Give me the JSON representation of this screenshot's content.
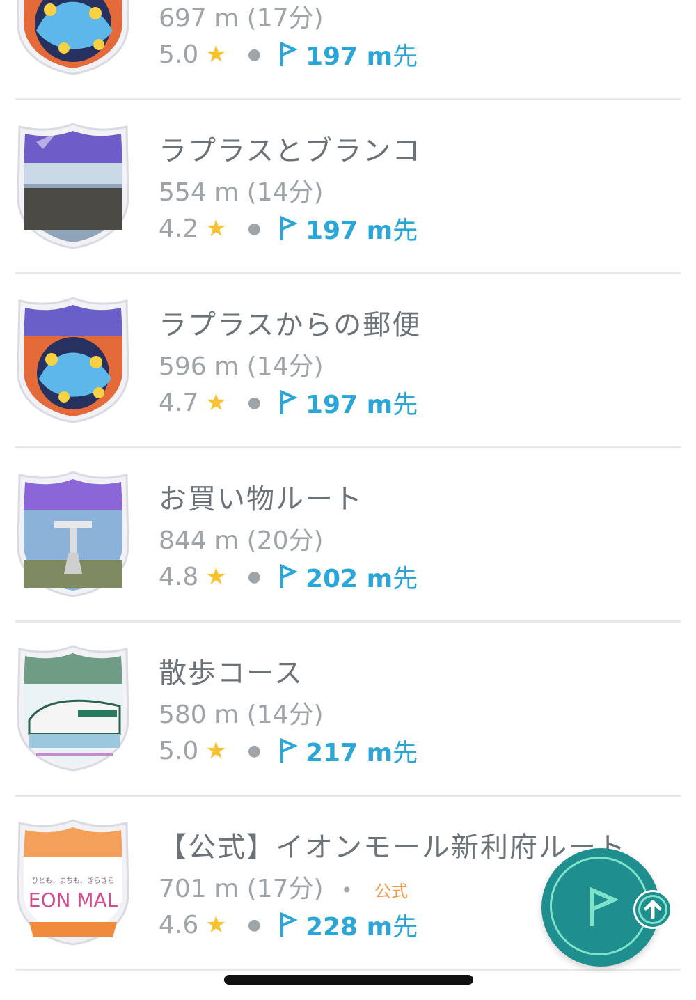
{
  "routes": [
    {
      "title": "",
      "distance": "697 m (17分)",
      "rating": "5.0",
      "ahead": "197 m",
      "ahead_suffix": "先",
      "badge_color": "#7a6bd6",
      "badge_theme": "pokemon-lapras"
    },
    {
      "title": "ラプラスとブランコ",
      "distance": "554 m (14分)",
      "rating": "4.2",
      "ahead": "197 m",
      "ahead_suffix": "先",
      "badge_color": "#6e5cc8",
      "badge_theme": "photo-field"
    },
    {
      "title": "ラプラスからの郵便",
      "distance": "596 m (14分)",
      "rating": "4.7",
      "ahead": "197 m",
      "ahead_suffix": "先",
      "badge_color": "#6a5ec9",
      "badge_theme": "pokemon-lapras"
    },
    {
      "title": "お買い物ルート",
      "distance": "844 m (20分)",
      "rating": "4.8",
      "ahead": "202 m",
      "ahead_suffix": "先",
      "badge_color": "#8a66d8",
      "badge_theme": "photo-tower"
    },
    {
      "title": "散歩コース",
      "distance": "580 m (14分)",
      "rating": "5.0",
      "ahead": "217 m",
      "ahead_suffix": "先",
      "badge_color": "#6e9c85",
      "badge_theme": "train"
    },
    {
      "title": "【公式】イオンモール新利府ルート",
      "distance": "701 m (17分)",
      "official_label": "公式",
      "rating": "4.6",
      "ahead": "228 m",
      "ahead_suffix": "先",
      "badge_color": "#f4a05a",
      "badge_theme": "aeon-mall",
      "badge_text": "ひとも、まちも、きらきら",
      "badge_logo": "EON MAL"
    }
  ],
  "colors": {
    "accent_blue": "#2aa6d9",
    "star": "#f7c330",
    "official": "#f29a47",
    "fab": "#1e8e8e",
    "fab_ring": "#7fe3c9"
  },
  "icons": {
    "rating": "star-icon",
    "distance_ahead": "flag-icon",
    "fab": "route-flag-icon",
    "fab_badge": "arrow-up-icon"
  }
}
